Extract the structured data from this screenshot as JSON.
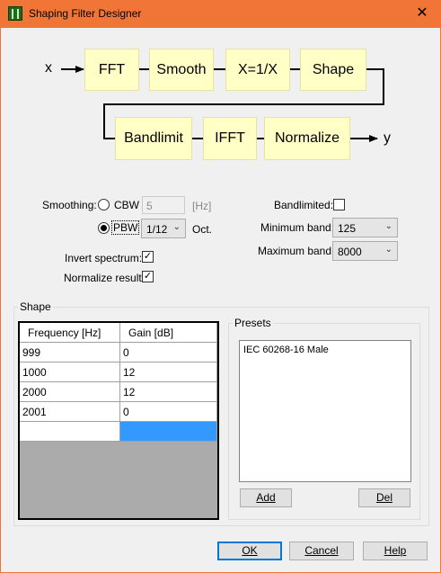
{
  "window": {
    "title": "Shaping Filter Designer",
    "close_glyph": "✕",
    "app_icon": "filter-app-icon"
  },
  "diagram": {
    "input_label": "x",
    "output_label": "y",
    "blocks": [
      "FFT",
      "Smooth",
      "X=1/X",
      "Shape",
      "Bandlimit",
      "IFFT",
      "Normalize"
    ]
  },
  "smoothing": {
    "label": "Smoothing:",
    "cbw": {
      "label": "CBW",
      "value": "5",
      "unit": "[Hz]",
      "selected": false
    },
    "pbw": {
      "label": "PBW",
      "value": "1/12",
      "unit": "Oct.",
      "selected": true
    }
  },
  "invert_spectrum": {
    "label": "Invert spectrum:",
    "checked": true
  },
  "normalize_result": {
    "label": "Normalize result:",
    "checked": true
  },
  "bandlimited": {
    "label": "Bandlimited:",
    "checked": false
  },
  "minimum_band": {
    "label": "Minimum band:",
    "value": "125"
  },
  "maximum_band": {
    "label": "Maximum band:",
    "value": "8000"
  },
  "shape": {
    "title": "Shape",
    "columns": [
      "Frequency [Hz]",
      "Gain [dB]"
    ],
    "rows": [
      [
        "999",
        "0"
      ],
      [
        "1000",
        "12"
      ],
      [
        "2000",
        "12"
      ],
      [
        "2001",
        "0"
      ],
      [
        "",
        ""
      ]
    ],
    "selected_cell_color": "#3399ff"
  },
  "presets": {
    "title": "Presets",
    "items": [
      "IEC 60268-16 Male"
    ],
    "add_label": "Add",
    "del_label": "Del"
  },
  "footer": {
    "ok_label": "OK",
    "cancel_label": "Cancel",
    "help_label": "Help"
  },
  "colors": {
    "title_bar": "#f07536",
    "block_fill": "#ffffc6",
    "default_button_border": "#0078d7"
  }
}
